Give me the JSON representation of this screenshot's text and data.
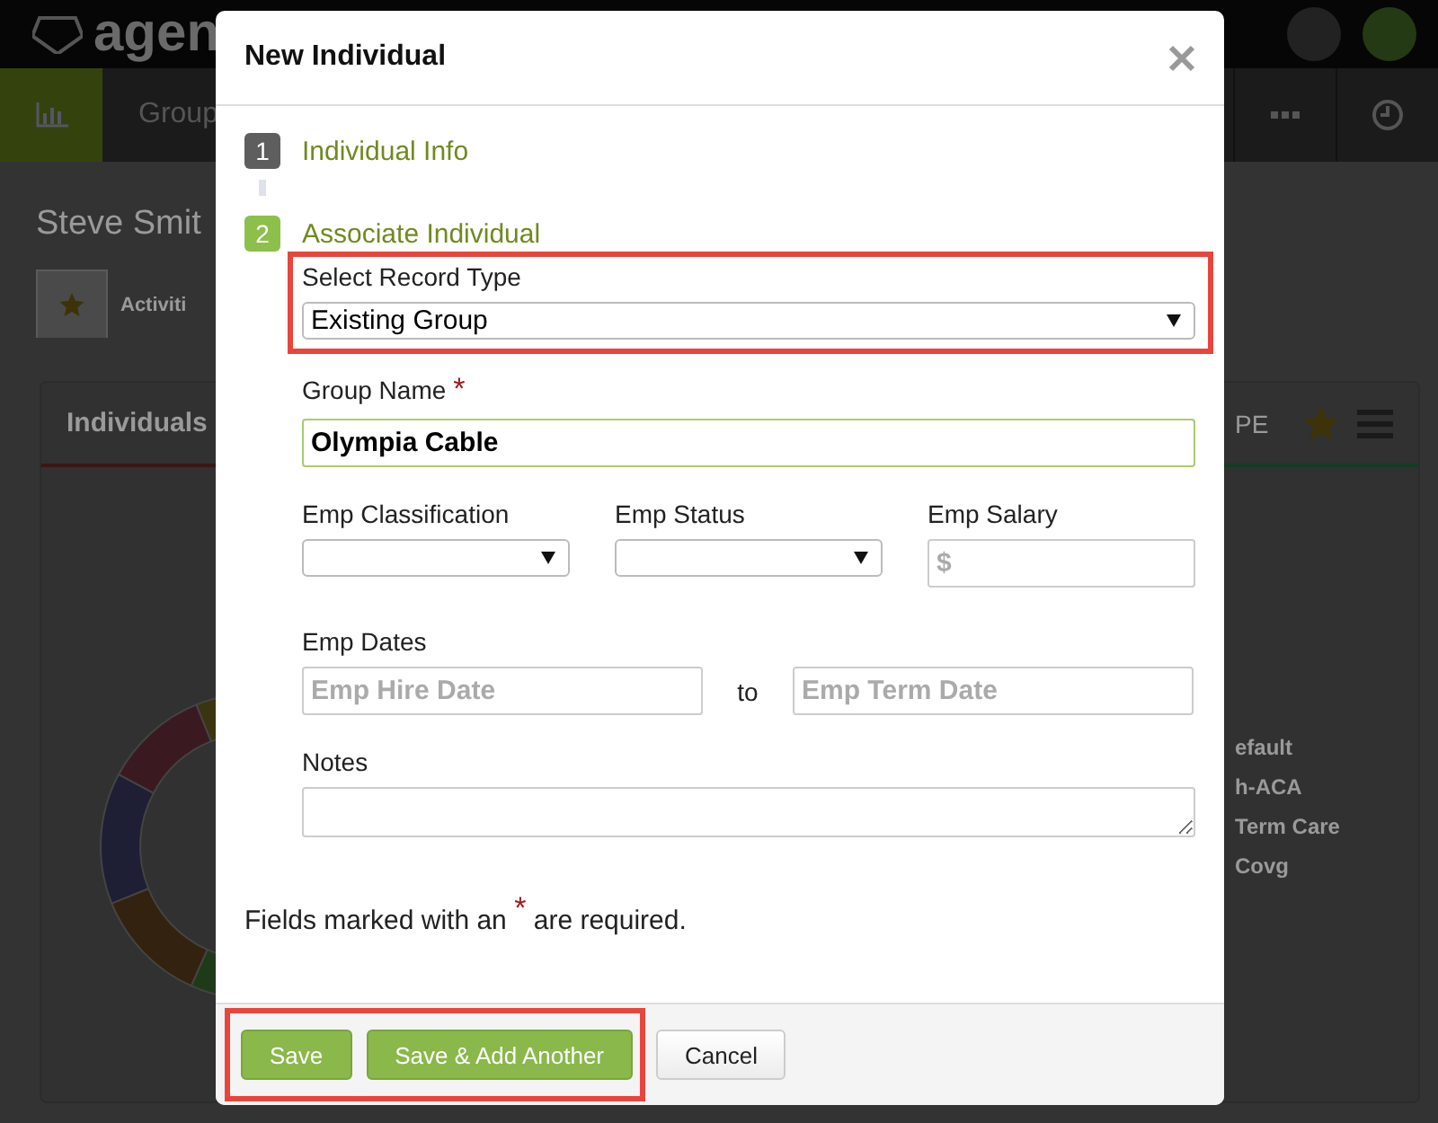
{
  "app": {
    "logo_text": "agen",
    "nav_items": [
      {
        "kind": "icon",
        "selected": true
      },
      {
        "kind": "text",
        "label": "Group",
        "selected": false
      }
    ]
  },
  "page": {
    "title": "Steve Smit",
    "tabs": [
      {
        "kind": "star",
        "selected": true
      },
      {
        "kind": "text",
        "label": "Activiti",
        "selected": false
      }
    ],
    "left_card": {
      "title": "Individuals"
    },
    "right_card": {
      "title": "PE",
      "legend": [
        "efault",
        "h-ACA",
        "Term Care",
        "Covg"
      ]
    }
  },
  "dialog": {
    "title": "New Individual",
    "steps": [
      {
        "number": "1",
        "label": "Individual Info",
        "selected": false
      },
      {
        "number": "2",
        "label": "Associate Individual",
        "selected": true
      }
    ],
    "record_type": {
      "label": "Select Record Type",
      "value": "Existing Group",
      "highlighted": true
    },
    "group_name": {
      "label": "Group Name",
      "required_mark": "*",
      "value": "Olympia Cable",
      "focused": true
    },
    "employment_fields": [
      {
        "kind": "select",
        "label": "Emp Classification"
      },
      {
        "kind": "select",
        "label": "Emp Status"
      },
      {
        "kind": "input",
        "label": "Emp Salary",
        "placeholder": "$"
      }
    ],
    "dates": {
      "label": "Emp Dates",
      "from_placeholder": "Emp Hire Date",
      "separator": "to",
      "to_placeholder": "Emp Term Date"
    },
    "notes": {
      "label": "Notes"
    },
    "required_note": "Fields marked with an $^{*}$ are required.",
    "highlighted_buttons": [
      {
        "label": "Save",
        "kind": "primary"
      },
      {
        "label": "Save & Add Another",
        "kind": "primary"
      }
    ],
    "buttons": [
      {
        "label": "Cancel",
        "kind": "default"
      }
    ]
  }
}
